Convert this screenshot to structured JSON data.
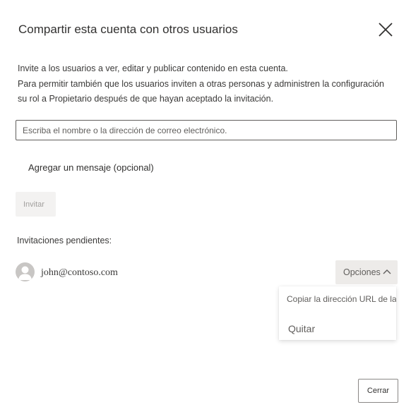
{
  "dialog": {
    "title": "Compartir esta cuenta con otros usuarios",
    "description_line1": "Invite a los usuarios a ver, editar y publicar contenido en esta cuenta.",
    "description_line2": "Para permitir también que los usuarios inviten a otras personas y administren la configuración",
    "description_line3": "su rol a Propietario después de que hayan aceptado la invitación.",
    "email_placeholder": "Escriba el nombre o la dirección de correo electrónico.",
    "add_message_label": "Agregar un mensaje (opcional)",
    "invite_label": "Invitar",
    "pending_label": "Invitaciones pendientes:",
    "close_label": "Cerrar"
  },
  "pending_invitations": [
    {
      "email": "john@contoso.com",
      "options_label": "Opciones"
    }
  ],
  "options_menu": {
    "copy_url_label": "Copiar la dirección URL de la invitación",
    "remove_label": "Quitar"
  },
  "icons": {
    "close": "close-icon",
    "avatar": "person-avatar-icon",
    "chevron": "chevron-up-icon"
  },
  "colors": {
    "text": "#323130",
    "input_border": "#605e5c",
    "disabled_button_bg": "#f3f2f1",
    "options_button_bg": "#edebe9",
    "avatar_bg": "#c8c6c4"
  }
}
